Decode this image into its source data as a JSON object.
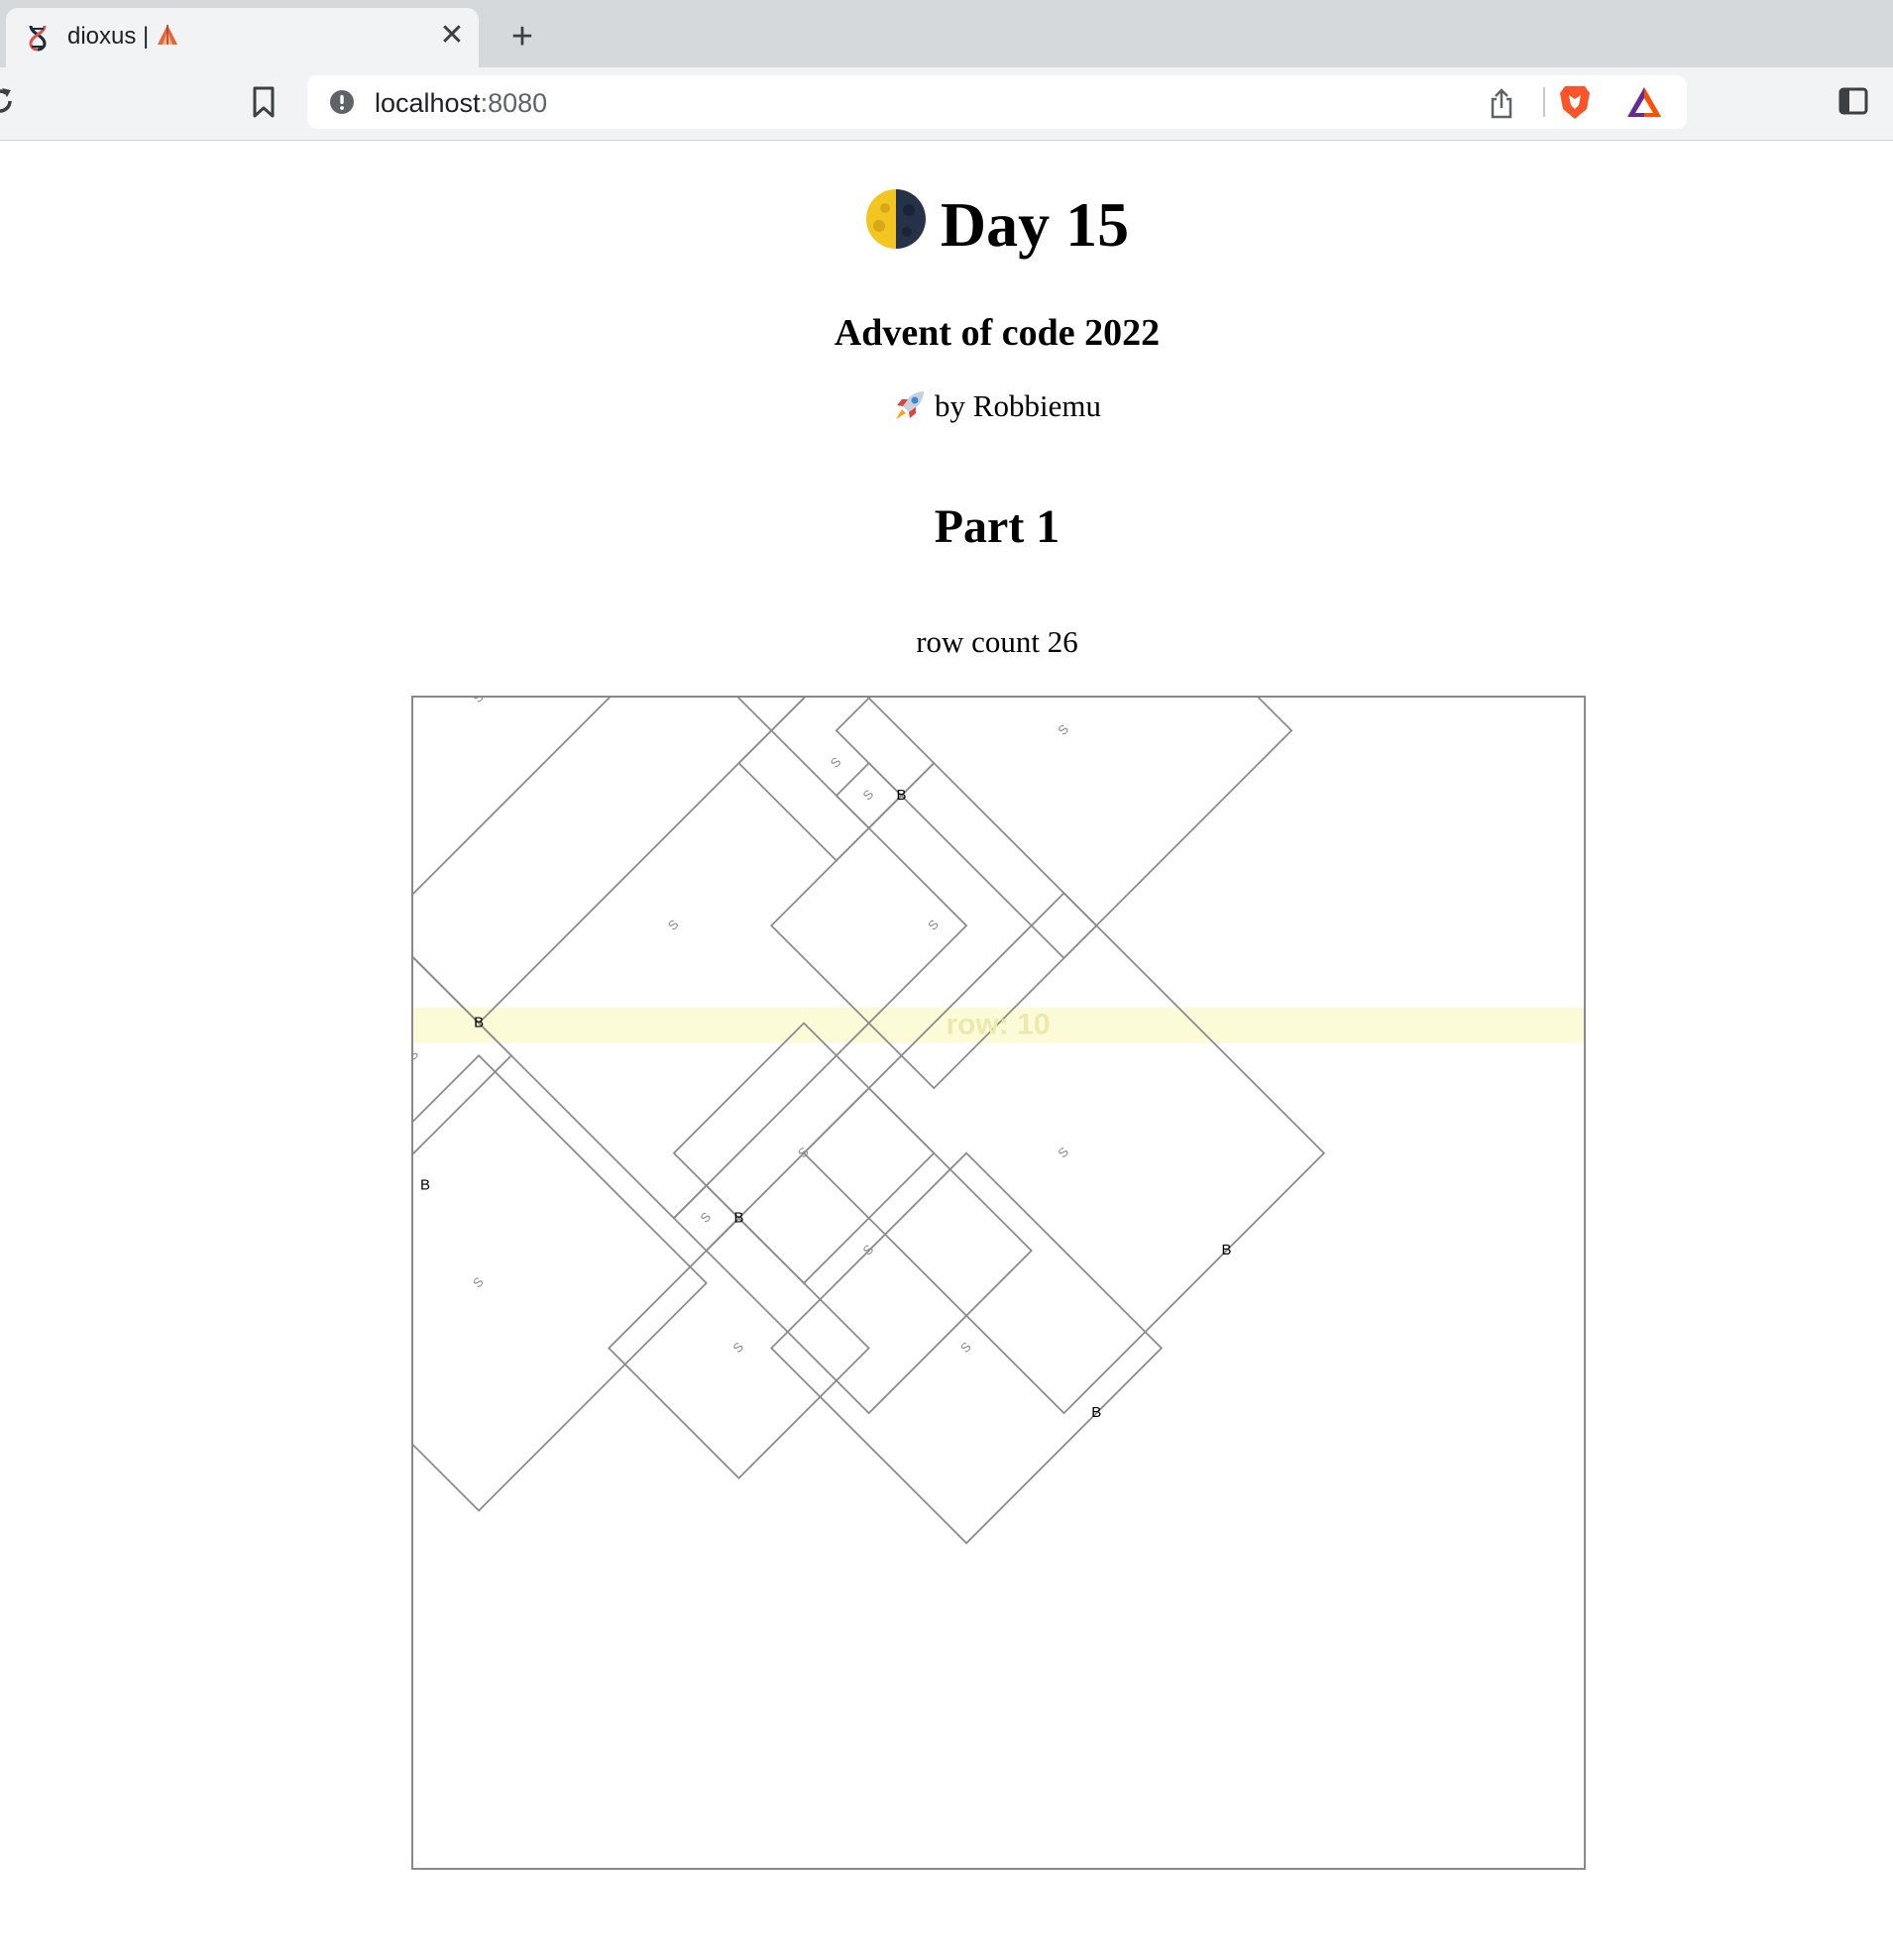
{
  "browser": {
    "tab_title": "dioxus | ",
    "tab_close": "✕",
    "new_tab": "+",
    "url_host": "localhost",
    "url_port": ":8080",
    "icons": [
      "dna-icon",
      "warning-tent-icon",
      "reload-icon",
      "bookmark-icon",
      "info-icon",
      "share-icon",
      "brave-lion-icon",
      "bat-triangle-icon",
      "sidepanel-icon"
    ]
  },
  "page": {
    "title": "Day 15",
    "subtitle": "Advent of code 2022",
    "byline": "by Robbiemu",
    "section": "Part 1",
    "row_count": "row count 26",
    "icons": [
      "half-moon-icon",
      "rocket-icon"
    ]
  },
  "viz": {
    "row_label": "row: 10",
    "row_value": 10,
    "highlight_color": "#fcfbd8",
    "row_label_color": "#ece9ad",
    "line_color": "#8c8c8c",
    "sensors": [
      {
        "label": "S",
        "x": 2,
        "y": 18,
        "beacon": [
          -2,
          15
        ]
      },
      {
        "label": "S",
        "x": 9,
        "y": 16,
        "beacon": [
          10,
          16
        ]
      },
      {
        "label": "S",
        "x": 13,
        "y": 2,
        "beacon": [
          15,
          3
        ]
      },
      {
        "label": "S",
        "x": 12,
        "y": 14,
        "beacon": [
          10,
          16
        ]
      },
      {
        "label": "S",
        "x": 10,
        "y": 20,
        "beacon": [
          10,
          16
        ]
      },
      {
        "label": "S",
        "x": 14,
        "y": 17,
        "beacon": [
          10,
          16
        ]
      },
      {
        "label": "S",
        "x": 8,
        "y": 7,
        "beacon": [
          2,
          10
        ]
      },
      {
        "label": "S",
        "x": 2,
        "y": 0,
        "beacon": [
          2,
          10
        ]
      },
      {
        "label": "S",
        "x": 0,
        "y": 11,
        "beacon": [
          2,
          10
        ]
      },
      {
        "label": "S",
        "x": 20,
        "y": 14,
        "beacon": [
          25,
          17
        ]
      },
      {
        "label": "S",
        "x": 17,
        "y": 20,
        "beacon": [
          21,
          22
        ]
      },
      {
        "label": "S",
        "x": 16,
        "y": 7,
        "beacon": [
          15,
          3
        ]
      },
      {
        "label": "S",
        "x": 14,
        "y": 3,
        "beacon": [
          15,
          3
        ]
      },
      {
        "label": "S",
        "x": 20,
        "y": 1,
        "beacon": [
          15,
          3
        ]
      }
    ],
    "beacon_label": "B",
    "beacons": [
      [
        -2,
        15
      ],
      [
        10,
        16
      ],
      [
        15,
        3
      ],
      [
        2,
        10
      ],
      [
        25,
        17
      ],
      [
        21,
        22
      ]
    ]
  }
}
